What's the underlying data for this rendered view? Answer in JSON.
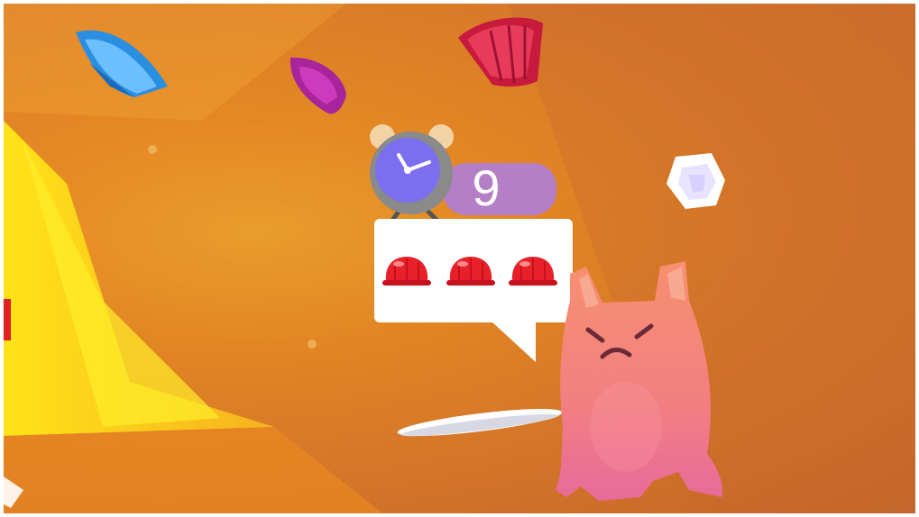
{
  "hud": {
    "timer_value": "9",
    "timer_icon": "alarm-clock-icon",
    "order_icon": "jelly-icon",
    "order_count": 3
  },
  "scene": {
    "character": "angry-pink-jelly-cat",
    "items": [
      "blue-gem",
      "purple-gem",
      "red-jelly",
      "white-gem",
      "white-plate"
    ]
  },
  "colors": {
    "timer_bar": "#b47fc6",
    "clock_face": "#7b6ff0",
    "jelly_red": "#e8202a",
    "character_pink": "#f4837a",
    "background_orange": "#e38a2c"
  }
}
